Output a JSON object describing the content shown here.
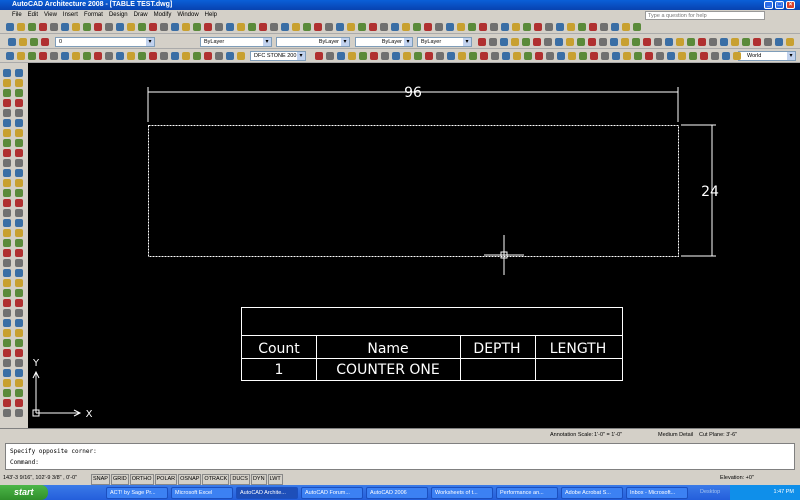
{
  "window": {
    "title": "AutoCAD Architecture 2008 - [TABLE TEST.dwg]",
    "help_placeholder": "Type a question for help"
  },
  "menu": [
    "File",
    "Edit",
    "View",
    "Insert",
    "Format",
    "Design",
    "Draw",
    "Modify",
    "Window",
    "Help"
  ],
  "toolbar": {
    "layer": "0",
    "color": "ByLayer",
    "linetype": "ByLayer",
    "lineweight": "ByLayer",
    "plotstyle": "ByLayer",
    "dimstyle": "DFC STONE 200",
    "ucs": "World"
  },
  "drawing": {
    "width_dim": "96",
    "height_dim": "24",
    "table": {
      "headers": [
        "Count",
        "Name",
        "DEPTH",
        "LENGTH"
      ],
      "rows": [
        [
          "1",
          "COUNTER ONE",
          "",
          ""
        ]
      ]
    },
    "ucs_x": "X",
    "ucs_y": "Y"
  },
  "annotation_bar": {
    "scale_label": "Annotation Scale:",
    "scale": "1'-0\" = 1'-0\"",
    "detail": "Medium Detail",
    "cut_plane": "Cut Plane: 3'-6\""
  },
  "command": {
    "history": "Specify opposite corner:",
    "prompt": "Command:"
  },
  "status": {
    "coords": "143'-3 9/16\", 102'-9 3/8\" , 0'-0\"",
    "toggles": [
      "SNAP",
      "GRID",
      "ORTHO",
      "POLAR",
      "OSNAP",
      "OTRACK",
      "DUCS",
      "DYN",
      "LWT"
    ],
    "elevation": "Elevation: +0\""
  },
  "taskbar": {
    "start": "start",
    "tasks": [
      "ACT! by Sage Pr...",
      "Microsoft Excel",
      "AutoCAD Archite...",
      "AutoCAD Forum...",
      "AutoCAD 2006",
      "Worksheets of t...",
      "Performance an...",
      "Adobe Acrobat S...",
      "Inbox - Microsoft..."
    ],
    "desktop": "Desktop",
    "time": "1:47 PM"
  },
  "colors": {
    "canvas": "#000000",
    "geometry": "#ffffff"
  }
}
